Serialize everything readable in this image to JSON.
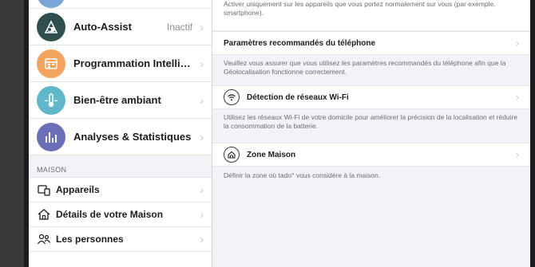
{
  "sidebar": {
    "items": [
      {
        "label": "Auto-Assist",
        "value": "Inactif",
        "icon": "auto-assist-icon",
        "color": "#2f4f4f"
      },
      {
        "label": "Programmation Intellige…",
        "icon": "calendar-icon",
        "color": "#f2a35e"
      },
      {
        "label": "Bien-être ambiant",
        "icon": "thermometer-icon",
        "color": "#5fb7c9"
      },
      {
        "label": "Analyses & Statistiques",
        "icon": "chart-icon",
        "color": "#6b6fb8"
      }
    ],
    "section_title": "MAISON",
    "maison_items": [
      {
        "label": "Appareils",
        "icon": "devices-icon"
      },
      {
        "label": "Détails de votre Maison",
        "icon": "house-icon"
      },
      {
        "label": "Les personnes",
        "icon": "people-icon"
      }
    ]
  },
  "main": {
    "top_text": "Activer uniquement sur les appareils que vous portez normalement sur vous (par exemple. smartphone).",
    "rows": [
      {
        "label": "Paramètres recommandés du téléphone",
        "desc": "Veuillez vous assurer que vous utilisez les paramètres recommandés du téléphone afin que la Géolocalisation fonctionne correctement."
      },
      {
        "label": "Détection de réseaux Wi-Fi",
        "icon": "wifi-icon",
        "desc": "Utilisez les réseaux Wi-Fi de votre domicile pour améliorer la précision de la localisation et réduire la consommation de la batterie."
      },
      {
        "label": "Zone Maison",
        "icon": "home-zone-icon",
        "desc": "Définir la zone où tado° vous considère à la maison."
      }
    ]
  }
}
